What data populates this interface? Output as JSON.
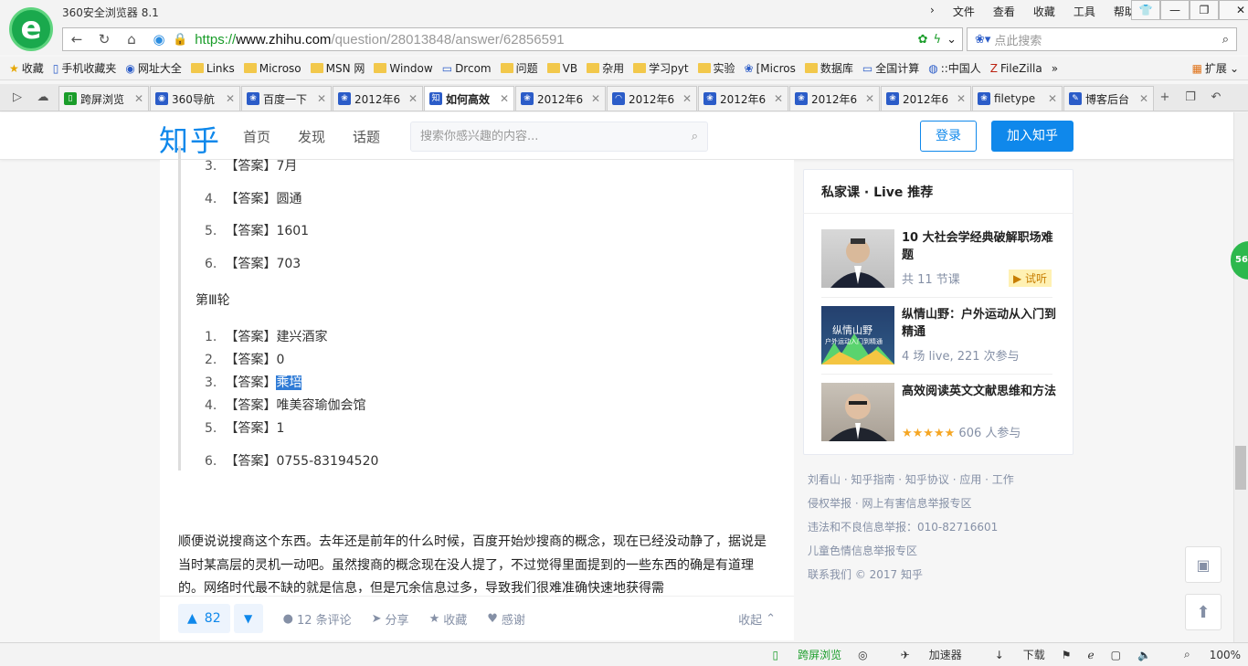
{
  "browser": {
    "title": "360安全浏览器 8.1",
    "menu": [
      "文件",
      "查看",
      "收藏",
      "工具",
      "帮助"
    ],
    "url_scheme": "https://",
    "url_domain": "www.zhihu.com",
    "url_path": "/question/28013848/answer/62856591",
    "search_placeholder": "点此搜索",
    "logo_glyph": "e"
  },
  "bookmarks": [
    {
      "label": "收藏",
      "icon": "star-icon"
    },
    {
      "label": "手机收藏夹",
      "icon": "phone-icon"
    },
    {
      "label": "网址大全",
      "icon": "nav-icon"
    },
    {
      "label": "Links",
      "icon": "folder-icon"
    },
    {
      "label": "Microso",
      "icon": "folder-icon"
    },
    {
      "label": "MSN 网",
      "icon": "folder-icon"
    },
    {
      "label": "Window",
      "icon": "folder-icon"
    },
    {
      "label": "Drcom",
      "icon": "page-icon"
    },
    {
      "label": "问题",
      "icon": "folder-icon"
    },
    {
      "label": "VB",
      "icon": "folder-icon"
    },
    {
      "label": "杂用",
      "icon": "folder-icon"
    },
    {
      "label": "学习pyt",
      "icon": "folder-icon"
    },
    {
      "label": "实验",
      "icon": "folder-icon"
    },
    {
      "label": "[Micros",
      "icon": "paw-icon"
    },
    {
      "label": "数据库",
      "icon": "folder-icon"
    },
    {
      "label": "全国计算",
      "icon": "page-icon"
    },
    {
      "label": "::中国人",
      "icon": "globe-icon"
    },
    {
      "label": "FileZilla",
      "icon": "fz-icon"
    }
  ],
  "bookmark_more": "»",
  "bookmark_ext": "扩展",
  "tabs": [
    {
      "label": "跨屏浏览",
      "fav": "▯",
      "active": false
    },
    {
      "label": "360导航",
      "fav": "◉",
      "active": false
    },
    {
      "label": "百度一下",
      "fav": "❀",
      "active": false
    },
    {
      "label": "2012年6",
      "fav": "❀",
      "active": false
    },
    {
      "label": "如何高效",
      "fav": "知",
      "active": true
    },
    {
      "label": "2012年6",
      "fav": "❀",
      "active": false
    },
    {
      "label": "2012年6",
      "fav": "◠",
      "active": false
    },
    {
      "label": "2012年6",
      "fav": "❀",
      "active": false
    },
    {
      "label": "2012年6",
      "fav": "❀",
      "active": false
    },
    {
      "label": "2012年6",
      "fav": "❀",
      "active": false
    },
    {
      "label": "filetype",
      "fav": "❀",
      "active": false
    },
    {
      "label": "博客后台",
      "fav": "✎",
      "active": false
    }
  ],
  "zhihu": {
    "logo": "知乎",
    "nav": [
      "首页",
      "发现",
      "话题"
    ],
    "search_placeholder": "搜索你感兴趣的内容...",
    "login": "登录",
    "join": "加入知乎"
  },
  "answer": {
    "list1": [
      {
        "n": "3.",
        "prefix": "【答案】",
        "value": "7月"
      },
      {
        "n": "4.",
        "prefix": "【答案】",
        "value": "圆通"
      },
      {
        "n": "5.",
        "prefix": "【答案】",
        "value": "1601"
      },
      {
        "n": "6.",
        "prefix": "【答案】",
        "value": "703"
      }
    ],
    "round3": "第Ⅲ轮",
    "list2": [
      {
        "n": "1.",
        "prefix": "【答案】",
        "value": "建兴酒家"
      },
      {
        "n": "2.",
        "prefix": "【答案】",
        "value": "0"
      },
      {
        "n": "3.",
        "prefix": "【答案】",
        "value": "乘培"
      },
      {
        "n": "4.",
        "prefix": "【答案】",
        "value": "唯美容瑜伽会馆"
      },
      {
        "n": "5.",
        "prefix": "【答案】",
        "value": "1"
      },
      {
        "n": "6.",
        "prefix": "【答案】",
        "value": "0755-83194520"
      }
    ],
    "paragraph": "顺便说说搜商这个东西。去年还是前年的什么时候，百度开始炒搜商的概念，现在已经没动静了，据说是当时某高层的灵机一动吧。虽然搜商的概念现在没人提了，不过觉得里面提到的一些东西的确是有道理的。网络时代最不缺的就是信息，但是冗余信息过多，导致我们很难准确快速地获得需"
  },
  "actions": {
    "votes": "82",
    "comments": "12 条评论",
    "share": "分享",
    "favorite": "收藏",
    "thanks": "感谢",
    "collapse": "收起"
  },
  "sidebar": {
    "title": "私家课 · Live 推荐",
    "lives": [
      {
        "title": "10 大社会学经典破解职场难题",
        "meta": "共 11 节课",
        "badge": "▶ 试听"
      },
      {
        "title": "纵情山野：户外运动从入门到精通",
        "meta": "4 场 live, 221 次参与",
        "cover1": "纵情山野",
        "cover2": "户外运动入门到精通"
      },
      {
        "title": "高效阅读英文文献思维和方法",
        "meta": "606 人参与",
        "stars": "★★★★★"
      }
    ]
  },
  "footer": {
    "line1": "刘看山 · 知乎指南 · 知乎协议 · 应用 · 工作",
    "line2": "侵权举报 · 网上有害信息举报专区",
    "line3": "违法和不良信息举报：010-82716601",
    "line4": "儿童色情信息举报专区",
    "line5": "联系我们 © 2017 知乎"
  },
  "floating_ball": "56",
  "status": {
    "cross": "跨屏浏览",
    "accel": "加速器",
    "download": "下载",
    "zoom": "100%"
  }
}
